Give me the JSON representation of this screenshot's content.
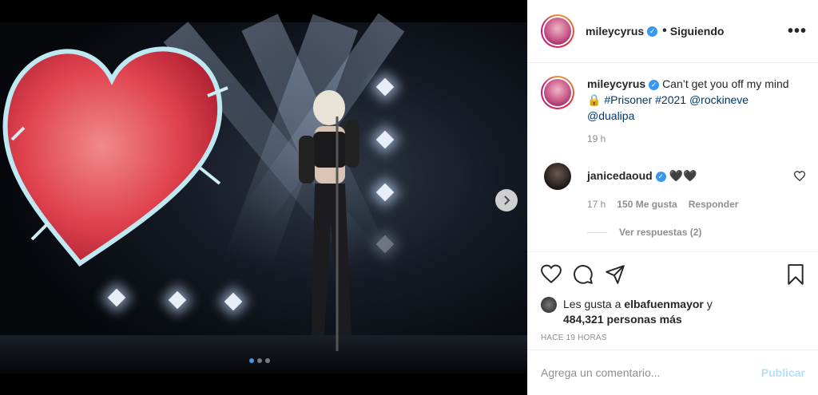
{
  "post": {
    "username": "mileycyrus",
    "follow_status": "Siguiendo",
    "more": "•••",
    "caption_plain": "Can’t get you off my mind 🔒",
    "caption_hashtags": "#Prisoner #2021",
    "caption_mentions_1": "@rockineve",
    "caption_mentions_2": "@dualipa",
    "caption_time": "19 h",
    "separator": "•"
  },
  "comment": {
    "username": "janicedaoud",
    "text": "🖤🖤",
    "time": "17 h",
    "likes": "150 Me gusta",
    "reply": "Responder",
    "view_replies": "Ver respuestas (2)"
  },
  "likes": {
    "prefix": "Les gusta a",
    "user": "elbafuenmayor",
    "conj": "y",
    "others": "484,321 personas más"
  },
  "posted_ago": "HACE 19 HORAS",
  "add_comment": {
    "placeholder": "Agrega un comentario...",
    "publish": "Publicar"
  },
  "carousel": {
    "slides": 3,
    "active": 1
  },
  "colors": {
    "verified": "#3897f0",
    "link": "#00376b",
    "publish_disabled": "#b2dffc",
    "secondary_text": "#8e8e8e"
  },
  "icons": [
    "more-options-icon",
    "verified-icon",
    "next-arrow-icon",
    "heart-icon",
    "comment-icon",
    "share-icon",
    "bookmark-icon",
    "like-comment-icon"
  ]
}
